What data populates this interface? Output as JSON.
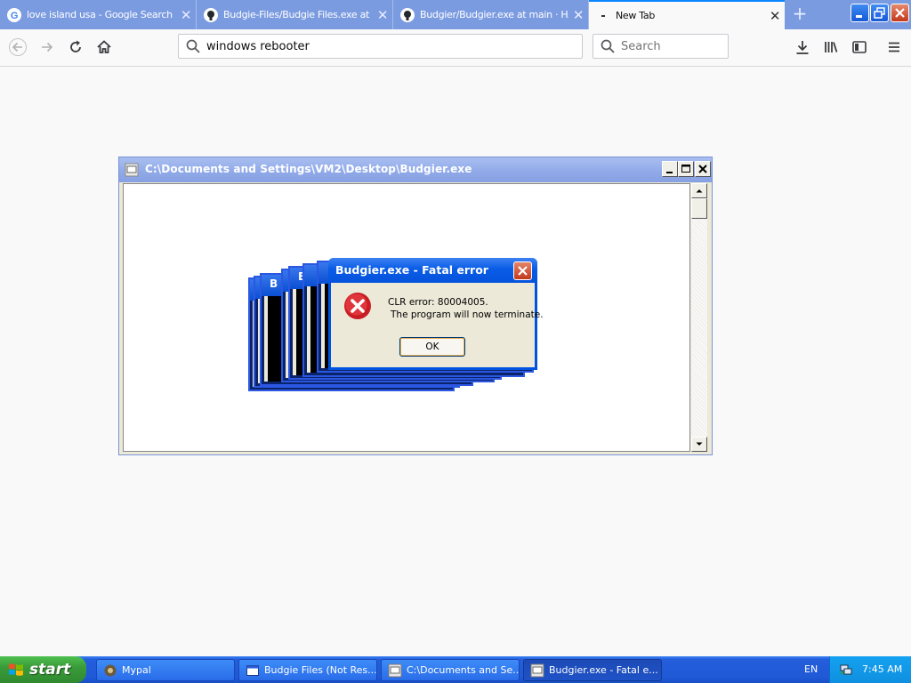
{
  "browser": {
    "tabs": [
      {
        "title": "love island usa - Google Search",
        "icon": "google-icon",
        "active": false
      },
      {
        "title": "Budgie-Files/Budgie Files.exe at m",
        "icon": "github-icon",
        "active": false
      },
      {
        "title": "Budgier/Budgier.exe at main · HA",
        "icon": "github-icon",
        "active": false
      },
      {
        "title": "New Tab",
        "icon": "newtab-icon",
        "active": true
      }
    ],
    "close_glyph": "✕",
    "newtab_glyph": "+",
    "url_value": "windows rebooter",
    "search_placeholder": "Search"
  },
  "console_window": {
    "title": "C:\\Documents and Settings\\VM2\\Desktop\\Budgier.exe"
  },
  "dialog": {
    "title": "Budgier.exe - Fatal error",
    "line1": "CLR error: 80004005.",
    "line2": "The program will now terminate.",
    "ok_label": "OK",
    "ghost_letters": [
      "B",
      "B"
    ]
  },
  "taskbar": {
    "start_label": "start",
    "tasks": [
      {
        "label": "Mypal",
        "icon": "mypal-icon",
        "active": false
      },
      {
        "label": "Budgie Files (Not Res...",
        "icon": "window-icon",
        "active": false
      },
      {
        "label": "C:\\Documents and Se...",
        "icon": "console-icon",
        "active": false
      },
      {
        "label": "Budgier.exe - Fatal e...",
        "icon": "console-icon",
        "active": true
      }
    ],
    "language": "EN",
    "clock": "7:45 AM"
  },
  "colors": {
    "accent": "#0a84ff",
    "xp_blue": "#245edb",
    "xp_green": "#3a9b3a",
    "error_red": "#d8252b"
  }
}
